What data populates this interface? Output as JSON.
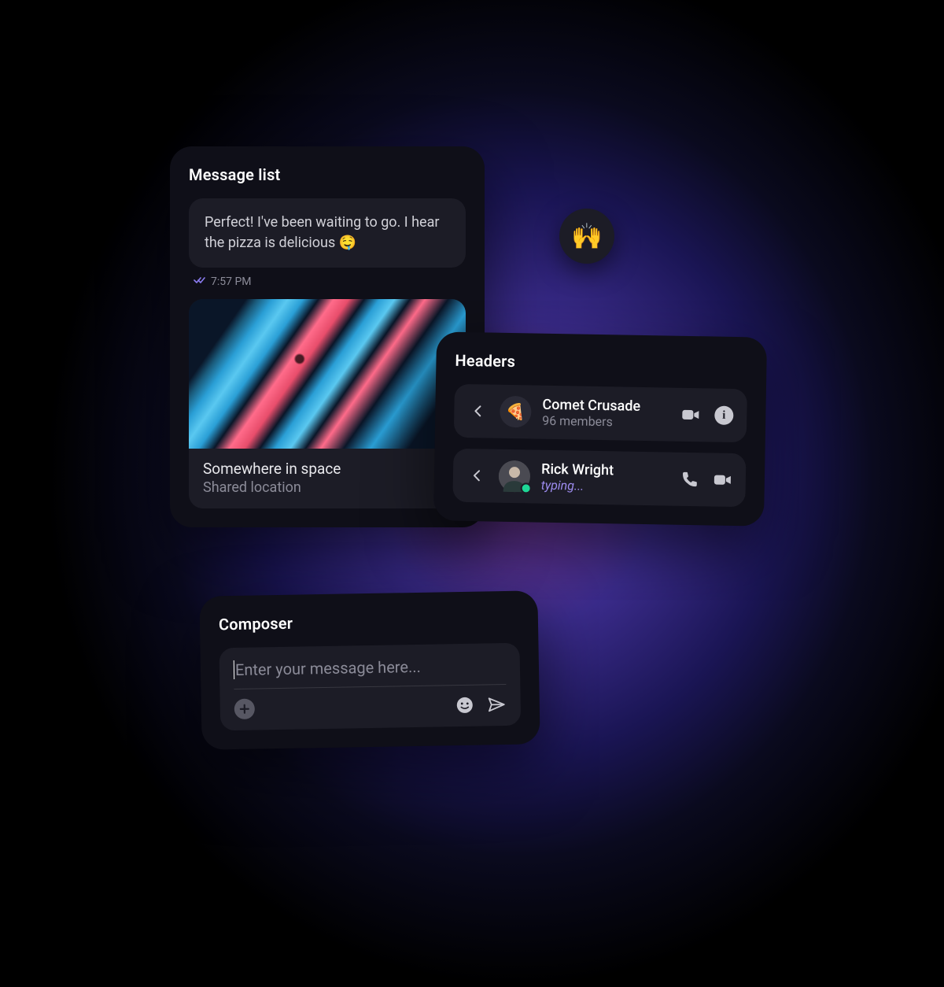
{
  "message_list": {
    "title": "Message list",
    "bubble_text": "Perfect! I've been waiting to go. I hear the pizza is delicious 🤤",
    "timestamp": "7:57 PM",
    "location": {
      "title": "Somewhere in space",
      "subtitle": "Shared location"
    }
  },
  "reaction": {
    "emoji": "🙌"
  },
  "headers": {
    "title": "Headers",
    "rows": [
      {
        "name": "Comet Crusade",
        "subtitle": "96 members",
        "avatar_emoji": "🍕"
      },
      {
        "name": "Rick Wright",
        "subtitle": "typing..."
      }
    ]
  },
  "composer": {
    "title": "Composer",
    "placeholder": "Enter your message here..."
  }
}
